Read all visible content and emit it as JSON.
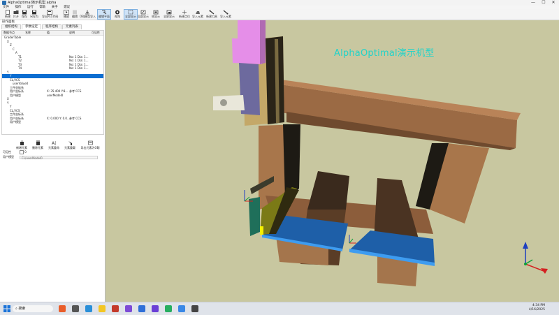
{
  "window": {
    "title": "AlphaOptimal演示机型.alpha",
    "minimize": "—",
    "maximize": "☐",
    "close": "✕"
  },
  "menu": [
    "文件",
    "操作",
    "运行",
    "帮助",
    "关于",
    "建议"
  ],
  "toolbar": [
    {
      "label": "新建",
      "icon": "new-icon"
    },
    {
      "label": "打开",
      "icon": "open-icon"
    },
    {
      "label": "保存",
      "icon": "save-icon"
    },
    {
      "label": "另存为",
      "icon": "save-as-icon"
    },
    {
      "label": "导出PLC代码",
      "icon": "export-icon"
    },
    {
      "label": "播放",
      "icon": "play-icon"
    },
    {
      "label": "编辑",
      "icon": "edit-icon"
    },
    {
      "label": "OBJ模型导入",
      "icon": "import-icon"
    },
    {
      "label": "编辑平面",
      "icon": "plane-icon"
    },
    {
      "label": "视角",
      "icon": "view-icon"
    },
    {
      "label": "全部显示",
      "icon": "fit-icon"
    },
    {
      "label": "局部显示",
      "icon": "zoom-icon"
    },
    {
      "label": "帧显示",
      "icon": "frame-icon"
    },
    {
      "label": "全屏显示",
      "icon": "fullscreen-icon"
    },
    {
      "label": "新建点位",
      "icon": "add-point-icon"
    },
    {
      "label": "导入元素",
      "icon": "import-element-icon"
    },
    {
      "label": "新建刀具",
      "icon": "tool-icon"
    },
    {
      "label": "导入元素",
      "icon": "element-icon"
    }
  ],
  "panel": {
    "title": "操作面板",
    "tabs": [
      "组织结构",
      "参数设定",
      "程序结构",
      "元素列表"
    ],
    "tree_headers": [
      "数据节点",
      "名称",
      "值",
      "说明",
      "可见性"
    ],
    "tree_rows": [
      {
        "indent": 0,
        "c1": "GraderTable",
        "c2": "",
        "c3": "",
        "sel": false
      },
      {
        "indent": 1,
        "c1": "X",
        "c2": "",
        "c3": "",
        "sel": false
      },
      {
        "indent": 2,
        "c1": "Z",
        "c2": "",
        "c3": "",
        "sel": false
      },
      {
        "indent": 3,
        "c1": "C",
        "c2": "",
        "c3": "",
        "sel": false
      },
      {
        "indent": 4,
        "c1": "A",
        "c2": "",
        "c3": "",
        "sel": false
      },
      {
        "indent": 5,
        "c1": "T1",
        "c2": "",
        "c3": "No: 1  Dia: 1...",
        "sel": false
      },
      {
        "indent": 5,
        "c1": "T2",
        "c2": "",
        "c3": "No: 1  Dia: 1...",
        "sel": false
      },
      {
        "indent": 5,
        "c1": "T3",
        "c2": "",
        "c3": "No: 1  Dia: 1...",
        "sel": false
      },
      {
        "indent": 5,
        "c1": "T4",
        "c2": "",
        "c3": "No: 1  Dia: 1...",
        "sel": false
      },
      {
        "indent": 1,
        "c1": "Y",
        "c2": "",
        "c3": "",
        "sel": false
      },
      {
        "indent": 2,
        "c1": "Y",
        "c2": "",
        "c3": "",
        "sel": true
      },
      {
        "indent": 2,
        "c1": "CL,VCS",
        "c2": "",
        "c3": "",
        "sel": false
      },
      {
        "indent": 3,
        "c1": "userValue0",
        "c2": "",
        "c3": "",
        "sel": false
      },
      {
        "indent": 2,
        "c1": "工件坐标系",
        "c2": "",
        "c3": "",
        "sel": false
      },
      {
        "indent": 2,
        "c1": "用户坐标系",
        "c2": "X: 35.400 Y:8...",
        "c3": "参考 CCS",
        "sel": false
      },
      {
        "indent": 2,
        "c1": "用户模型",
        "c2": "userModel0",
        "c3": "",
        "sel": false
      },
      {
        "indent": 1,
        "c1": "X",
        "c2": "",
        "c3": "",
        "sel": false
      },
      {
        "indent": 1,
        "c1": "Y",
        "c2": "",
        "c3": "",
        "sel": false
      },
      {
        "indent": 2,
        "c1": "Y",
        "c2": "",
        "c3": "",
        "sel": false
      },
      {
        "indent": 2,
        "c1": "CL,VCS",
        "c2": "",
        "c3": "",
        "sel": false
      },
      {
        "indent": 2,
        "c1": "工件坐标系",
        "c2": "",
        "c3": "",
        "sel": false
      },
      {
        "indent": 2,
        "c1": "用户坐标系",
        "c2": "X: 0.000 Y: 0.0...",
        "c3": "参考 CCS",
        "sel": false
      },
      {
        "indent": 2,
        "c1": "用户模型",
        "c2": "",
        "c3": "",
        "sel": false
      }
    ],
    "actions": [
      "新增元素",
      "删除元素",
      "元素重命",
      "元素重载",
      "导出元素为OBJ"
    ],
    "field_visible_label": "可见性",
    "field_visible_value": "0",
    "field_model_label": "用户模型",
    "field_model_value": "CL/userModel0"
  },
  "viewport": {
    "watermark": "AlphaOptimal演示机型",
    "background": "#c8c7a0"
  },
  "taskbar": {
    "search": "搜索",
    "time": "4:34 PM",
    "date": "4/16/2025"
  }
}
